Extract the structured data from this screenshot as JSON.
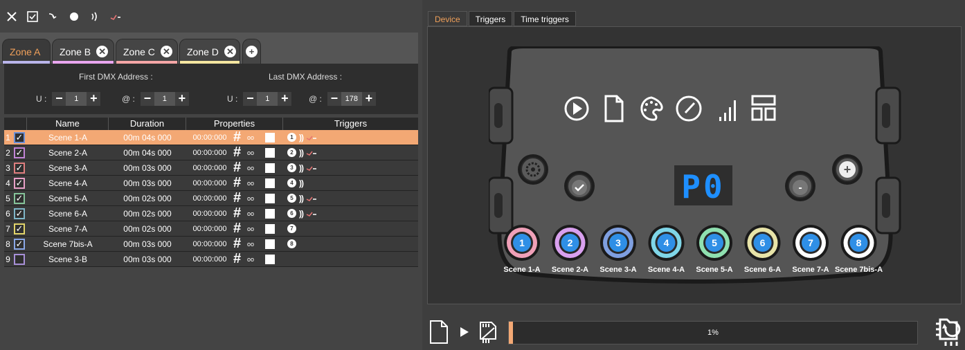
{
  "toolbar": {
    "icons": [
      "close-icon",
      "checkbox-icon",
      "step-down-icon",
      "record-icon",
      "wave-icon",
      "signal-icon"
    ]
  },
  "zones": [
    {
      "label": "Zone A",
      "color": "#b9b4ea",
      "active": true,
      "closable": false
    },
    {
      "label": "Zone B",
      "color": "#e9a6ef",
      "active": false,
      "closable": true
    },
    {
      "label": "Zone C",
      "color": "#f4a6a6",
      "active": false,
      "closable": true
    },
    {
      "label": "Zone D",
      "color": "#f5e6a0",
      "active": false,
      "closable": true
    }
  ],
  "zone_close_glyph": "✕",
  "zone_add_glyph": "+",
  "dmx": {
    "first_label": "First DMX Address :",
    "last_label": "Last DMX Address :",
    "u_label": "U :",
    "at_label": "@ :",
    "first_u": "1",
    "first_at": "1",
    "last_u": "1",
    "last_at": "178",
    "minus": "−",
    "plus": "+"
  },
  "table": {
    "headers": [
      "Name",
      "Duration",
      "Properties",
      "Triggers"
    ],
    "rows": [
      {
        "num": "1",
        "name": "Scene 1-A",
        "duration": "00m 04s 000",
        "time": "00:00:000",
        "checked": true,
        "color": "#6b8fd6",
        "trig": "1",
        "wave": true,
        "sig": true,
        "sel": true
      },
      {
        "num": "2",
        "name": "Scene 2-A",
        "duration": "00m 04s 000",
        "time": "00:00:000",
        "checked": true,
        "color": "#c184d6",
        "trig": "2",
        "wave": true,
        "sig": true,
        "sel": false
      },
      {
        "num": "3",
        "name": "Scene 3-A",
        "duration": "00m 03s 000",
        "time": "00:00:000",
        "checked": true,
        "color": "#e07f7f",
        "trig": "3",
        "wave": true,
        "sig": true,
        "sel": false
      },
      {
        "num": "4",
        "name": "Scene 4-A",
        "duration": "00m 03s 000",
        "time": "00:00:000",
        "checked": true,
        "color": "#e8a0c8",
        "trig": "4",
        "wave": true,
        "sig": false,
        "sel": false
      },
      {
        "num": "5",
        "name": "Scene 5-A",
        "duration": "00m 02s 000",
        "time": "00:00:000",
        "checked": true,
        "color": "#86c49a",
        "trig": "5",
        "wave": true,
        "sig": true,
        "sel": false
      },
      {
        "num": "6",
        "name": "Scene 6-A",
        "duration": "00m 02s 000",
        "time": "00:00:000",
        "checked": true,
        "color": "#7fb6c8",
        "trig": "6",
        "wave": true,
        "sig": true,
        "sel": false
      },
      {
        "num": "7",
        "name": "Scene 7-A",
        "duration": "00m 02s 000",
        "time": "00:00:000",
        "checked": true,
        "color": "#e3d56a",
        "trig": "7",
        "wave": false,
        "sig": false,
        "sel": false
      },
      {
        "num": "8",
        "name": "Scene 7bis-A",
        "duration": "00m 03s 000",
        "time": "00:00:000",
        "checked": true,
        "color": "#8aa8e8",
        "trig": "8",
        "wave": false,
        "sig": false,
        "sel": false
      },
      {
        "num": "9",
        "name": "Scene 3-B",
        "duration": "00m 03s 000",
        "time": "00:00:000",
        "checked": false,
        "color": "#a890d8",
        "trig": "",
        "wave": false,
        "sig": false,
        "sel": false
      }
    ],
    "hash": "#",
    "hash_sub": "oo",
    "check_glyph": "✓",
    "wave_glyph": "))"
  },
  "device_tabs": [
    {
      "label": "Device",
      "active": true
    },
    {
      "label": "Triggers",
      "active": false
    },
    {
      "label": "Time triggers",
      "active": false
    }
  ],
  "device": {
    "display": "P0",
    "top_icons": [
      "play-icon",
      "file-icon",
      "palette-icon",
      "speed-icon",
      "signal-bars-icon",
      "layout-icon"
    ],
    "buttons": [
      {
        "num": "1",
        "label": "Scene 1-A",
        "ring": "#f0a0b8"
      },
      {
        "num": "2",
        "label": "Scene 2-A",
        "ring": "#d9a0ef"
      },
      {
        "num": "3",
        "label": "Scene 3-A",
        "ring": "#7f9fe0"
      },
      {
        "num": "4",
        "label": "Scene 4-A",
        "ring": "#7fd6e8"
      },
      {
        "num": "5",
        "label": "Scene 5-A",
        "ring": "#8fe0b0"
      },
      {
        "num": "6",
        "label": "Scene 6-A",
        "ring": "#e8e4a8"
      },
      {
        "num": "7",
        "label": "Scene 7-A",
        "ring": "#ffffff"
      },
      {
        "num": "8",
        "label": "Scene 7bis-A",
        "ring": "#ffffff"
      }
    ],
    "minus": "-",
    "plus": "+"
  },
  "progress": {
    "label": "1%",
    "value": 1
  },
  "colors": {
    "accent": "#f0a05a",
    "selected_row": "#f3a874",
    "button_blue": "#2f8fe6",
    "display_blue": "#1e8fff"
  }
}
